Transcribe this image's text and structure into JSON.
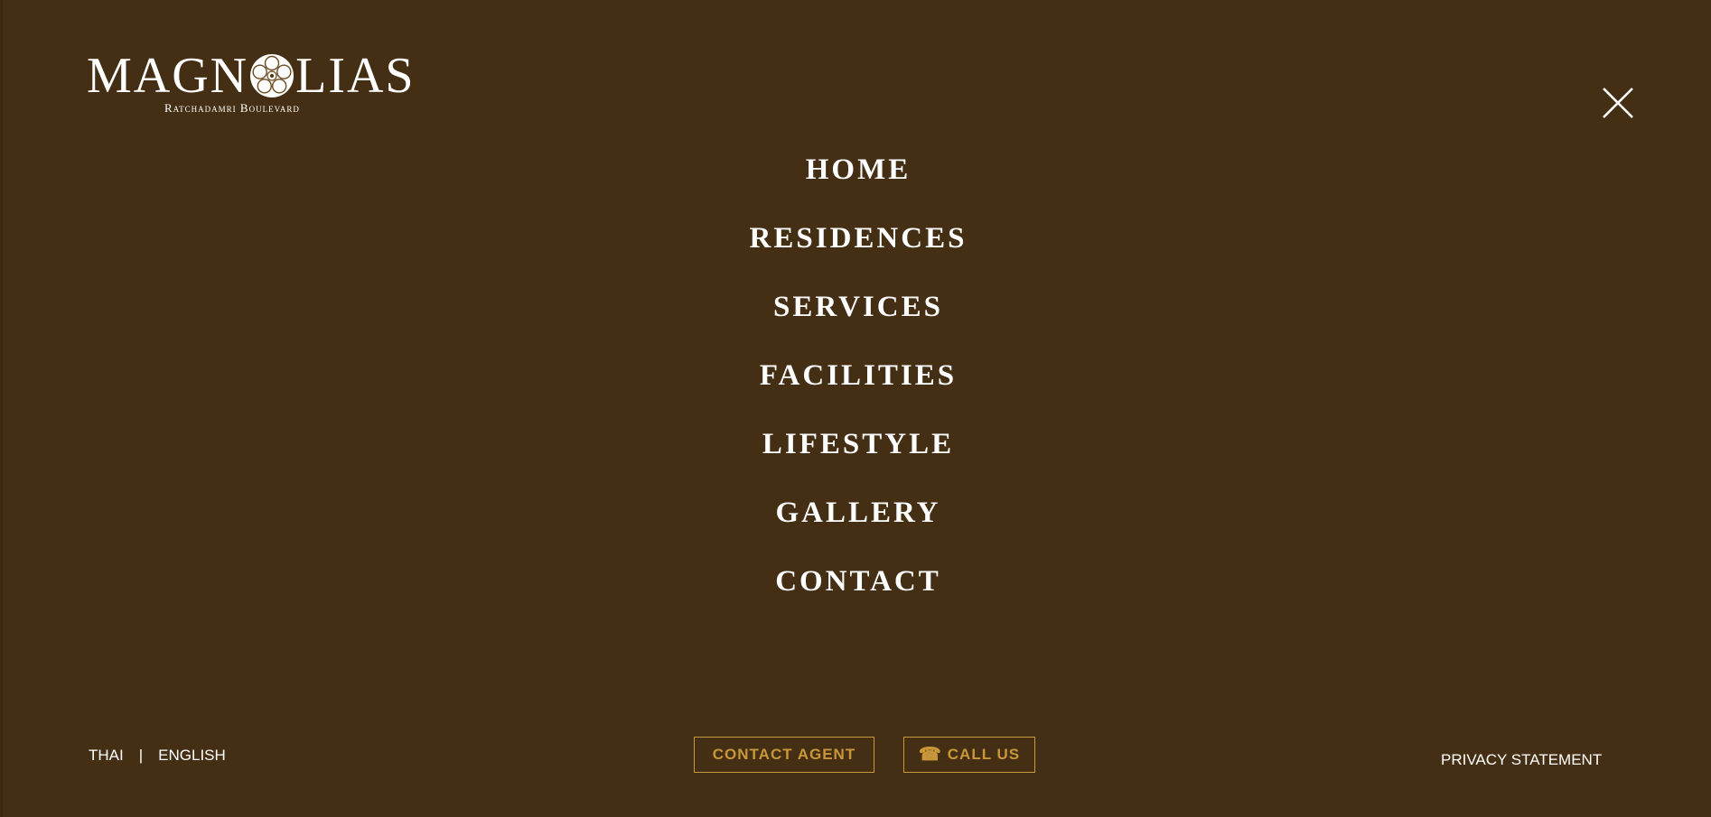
{
  "logo": {
    "word_left": "MAGN",
    "word_right": "LIAS",
    "subtitle": "Ratchadamri Boulevard"
  },
  "nav": {
    "items": [
      {
        "label": "HOME"
      },
      {
        "label": "RESIDENCES"
      },
      {
        "label": "SERVICES"
      },
      {
        "label": "FACILITIES"
      },
      {
        "label": "LIFESTYLE"
      },
      {
        "label": "GALLERY"
      },
      {
        "label": "CONTACT"
      }
    ]
  },
  "footer": {
    "lang_thai": "THAI",
    "lang_sep": "|",
    "lang_english": "ENGLISH",
    "contact_agent": "CONTACT AGENT",
    "call_us": "CALL US",
    "call_icon": "☎",
    "privacy": "PRIVACY STATEMENT"
  },
  "icons": {
    "close": "close-icon",
    "phone": "phone-icon",
    "flower": "magnolia-flower-icon"
  },
  "colors": {
    "background": "#442f14",
    "accent": "#c9973a",
    "text": "#ffffff"
  }
}
